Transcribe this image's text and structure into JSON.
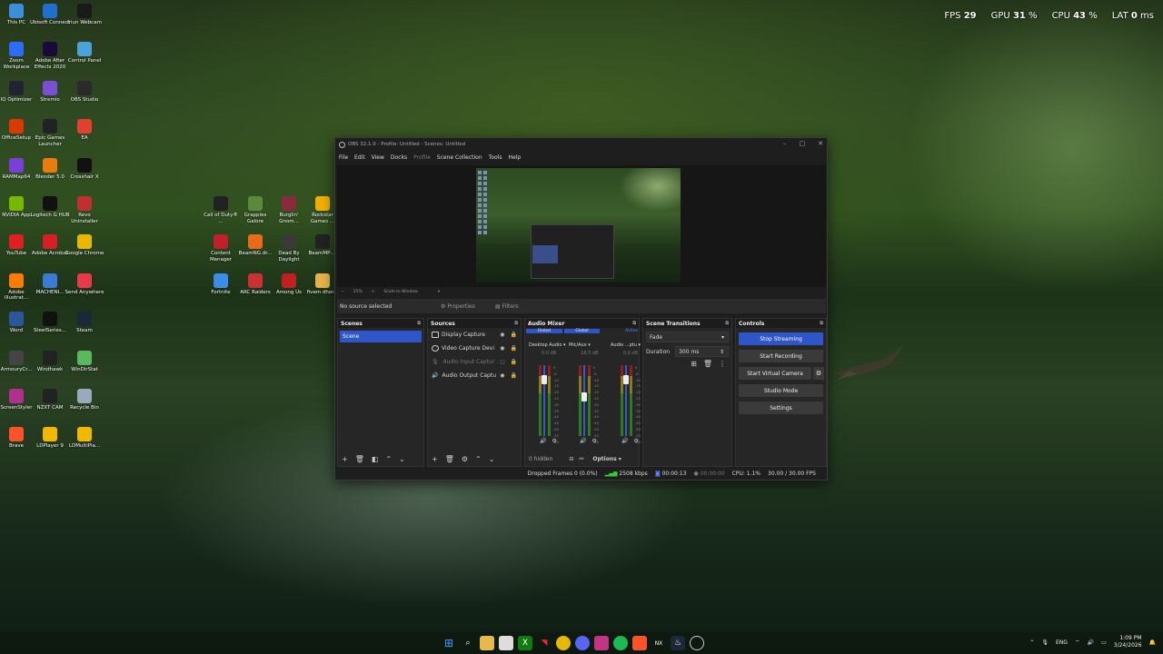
{
  "desktop_icons_col1": [
    {
      "label": "This PC",
      "color": "#3b8fd9"
    },
    {
      "label": "Zoom Workplace",
      "color": "#2d6cf5"
    },
    {
      "label": "IQ Optimizer",
      "color": "#223"
    },
    {
      "label": "OfficeSetup",
      "color": "#d83b01"
    },
    {
      "label": "RAMMap64",
      "color": "#7b3fd6"
    },
    {
      "label": "NVIDIA App",
      "color": "#76b900"
    },
    {
      "label": "YouTube",
      "color": "#e02020"
    },
    {
      "label": "Adobe Illustrat...",
      "color": "#ff7c00"
    },
    {
      "label": "Word",
      "color": "#2b579a"
    },
    {
      "label": "ArmouryCr...",
      "color": "#444"
    },
    {
      "label": "ScreenStyler",
      "color": "#b0308f"
    },
    {
      "label": "Brave",
      "color": "#fb542b"
    }
  ],
  "desktop_icons_col2": [
    {
      "label": "Ubisoft Connect",
      "color": "#1f6fd0"
    },
    {
      "label": "Adobe After Effects 2020",
      "color": "#1a0a3a"
    },
    {
      "label": "Stremio",
      "color": "#7a4fd4"
    },
    {
      "label": "Epic Games Launcher",
      "color": "#222"
    },
    {
      "label": "Blender 5.0",
      "color": "#e87d0d"
    },
    {
      "label": "Logitech G HUB",
      "color": "#111"
    },
    {
      "label": "Adobe Acrobat",
      "color": "#d81f26"
    },
    {
      "label": "MACHENI...",
      "color": "#3a7bd5"
    },
    {
      "label": "SteelSeries...",
      "color": "#111"
    },
    {
      "label": "Windhawk",
      "color": "#222"
    },
    {
      "label": "NZXT CAM",
      "color": "#222"
    },
    {
      "label": "LDPlayer 9",
      "color": "#f2b800"
    }
  ],
  "desktop_icons_col3": [
    {
      "label": "Iriun Webcam",
      "color": "#1a1a1a"
    },
    {
      "label": "Control Panel",
      "color": "#4ba3d9"
    },
    {
      "label": "OBS Studio",
      "color": "#2a2a2a"
    },
    {
      "label": "EA",
      "color": "#e04030"
    },
    {
      "label": "Crosshair X",
      "color": "#111"
    },
    {
      "label": "Revo Uninstaller",
      "color": "#c03030"
    },
    {
      "label": "Google Chrome",
      "color": "#e8b800"
    },
    {
      "label": "Send Anywhere",
      "color": "#e8394a"
    },
    {
      "label": "Steam",
      "color": "#1b2838"
    },
    {
      "label": "WinDirStat",
      "color": "#5cb85c"
    },
    {
      "label": "Recycle Bin",
      "color": "#9ab"
    },
    {
      "label": "LDMultiPla...",
      "color": "#f2b800"
    }
  ],
  "desktop_icons_col4": [
    {
      "label": "Call of Duty® ...",
      "color": "#222"
    },
    {
      "label": "Content Manager",
      "color": "#c0202a"
    },
    {
      "label": "Fortnite",
      "color": "#3a8ee8"
    }
  ],
  "desktop_icons_col5": [
    {
      "label": "Grapples Galore",
      "color": "#5a8a3a"
    },
    {
      "label": "BeamNG.dr...",
      "color": "#e86a1a"
    },
    {
      "label": "ARC Raiders",
      "color": "#cc3030"
    }
  ],
  "desktop_icons_col6": [
    {
      "label": "Burglin' Gnom...",
      "color": "#8a2a3a"
    },
    {
      "label": "Dead By Daylight",
      "color": "#3a3a3a"
    },
    {
      "label": "Among Us",
      "color": "#c02020"
    }
  ],
  "desktop_icons_col7": [
    {
      "label": "Rockstar Games ...",
      "color": "#f0b000"
    },
    {
      "label": "BeamMP-...",
      "color": "#222"
    },
    {
      "label": "fivem dhor...",
      "color": "#e8b24a"
    }
  ],
  "overlay": {
    "fps_label": "FPS",
    "fps": "29",
    "gpu_label": "GPU",
    "gpu": "31",
    "cpu_label": "CPU",
    "cpu": "43",
    "lat_label": "LAT",
    "lat": "0",
    "pct": "%",
    "ms": "ms"
  },
  "obs": {
    "title": "OBS 32.1.0 - Profile: Untitled - Scenes: Untitled",
    "menu": [
      "File",
      "Edit",
      "View",
      "Docks",
      "Profile",
      "Scene Collection",
      "Tools",
      "Help"
    ],
    "zoom": "25%",
    "scale_mode": "Scale to Window",
    "no_source": "No source selected",
    "properties": "Properties",
    "filters": "Filters",
    "docks": {
      "scenes": "Scenes",
      "sources": "Sources",
      "mixer": "Audio Mixer",
      "transitions": "Scene Transitions",
      "controls": "Controls"
    },
    "scenes": [
      "Scene"
    ],
    "sources": [
      {
        "name": "Display Capture",
        "dim": false
      },
      {
        "name": "Video Capture Devi",
        "dim": false
      },
      {
        "name": "Audio Input Captur",
        "dim": true
      },
      {
        "name": "Audio Output Captu",
        "dim": false
      }
    ],
    "mixer_tags": [
      "Global",
      "Global",
      "Active"
    ],
    "channels": [
      {
        "name": "Desktop Audio",
        "db": "0.0 dB",
        "level": 0.8
      },
      {
        "name": "Mic/Aux",
        "db": "-16.5 dB",
        "level": 0.55
      },
      {
        "name": "Audio ...ptu",
        "db": "0.0 dB",
        "level": 0.8
      }
    ],
    "scale": [
      "0",
      "-5",
      "-10",
      "-15",
      "-20",
      "-25",
      "-30",
      "-35",
      "-40",
      "-45",
      "-50",
      "-55",
      "-60"
    ],
    "hidden": "0 hidden",
    "options": "Options",
    "transition": "Fade",
    "duration_label": "Duration",
    "duration": "300 ms",
    "controls": [
      "Stop Streaming",
      "Start Recording",
      "Start Virtual Camera",
      "Studio Mode",
      "Settings"
    ],
    "status": {
      "dropped": "Dropped Frames 0 (0.0%)",
      "kbps": "2508 kbps",
      "stream_time": "00:00:13",
      "rec_time": "00:00:00",
      "cpu": "CPU: 1.1%",
      "fps": "30.00 / 30.00 FPS"
    }
  },
  "taskbar": {
    "lang": "ENG",
    "time": "1:09 PM",
    "date": "3/24/2026"
  }
}
